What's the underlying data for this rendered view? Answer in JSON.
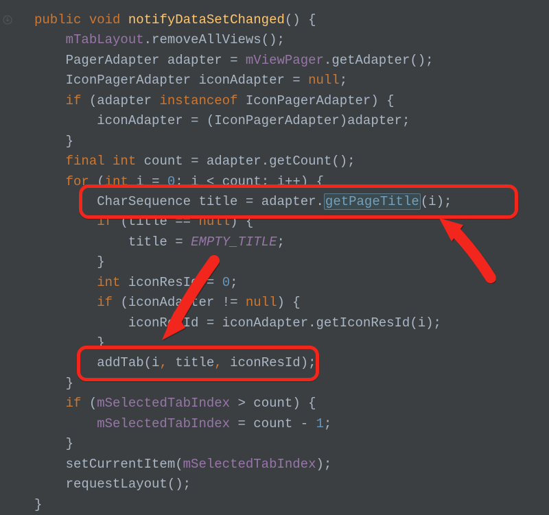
{
  "code": {
    "kw_public": "public",
    "kw_void": "void",
    "method_name": "notifyDataSetChanged",
    "l1_field": "mTabLayout",
    "l1_call": "removeAllViews",
    "l2_type1": "PagerAdapter",
    "l2_var": "adapter",
    "l2_field": "mViewPager",
    "l2_call": "getAdapter",
    "l3_type": "IconPagerAdapter",
    "l3_var": "iconAdapter",
    "kw_null": "null",
    "kw_if": "if",
    "kw_instanceof": "instanceof",
    "l4_rhs_type": "IconPagerAdapter",
    "l5_lhs": "iconAdapter",
    "l5_cast": "IconPagerAdapter",
    "l5_rhs": "adapter",
    "kw_final": "final",
    "kw_int": "int",
    "l7_var": "count",
    "l7_obj": "adapter",
    "l7_call": "getCount",
    "kw_for": "for",
    "l8_var": "i",
    "l8_init": "0",
    "l8_cond_rhs": "count",
    "l8_inc": "i++",
    "l9_type": "CharSequence",
    "l9_var": "title",
    "l9_obj": "adapter",
    "l9_call": "getPageTitle",
    "l9_arg": "i",
    "l10_lhs": "title",
    "l11_lhs": "title",
    "l11_const": "EMPTY_TITLE",
    "l13_var": "iconResId",
    "l13_val": "0",
    "l14_lhs": "iconAdapter",
    "l15_lhs": "iconResId",
    "l15_obj": "iconAdapter",
    "l15_call": "getIconResId",
    "l15_arg": "i",
    "l17_call": "addTab",
    "l17_a1": "i",
    "l17_a2": "title",
    "l17_a3": "iconResId",
    "l19_field": "mSelectedTabIndex",
    "l19_rhs": "count",
    "l20_lhs_field": "mSelectedTabIndex",
    "l20_rhs": "count",
    "l20_one": "1",
    "l22_call": "setCurrentItem",
    "l22_arg_field": "mSelectedTabIndex",
    "l23_call": "requestLayout"
  }
}
